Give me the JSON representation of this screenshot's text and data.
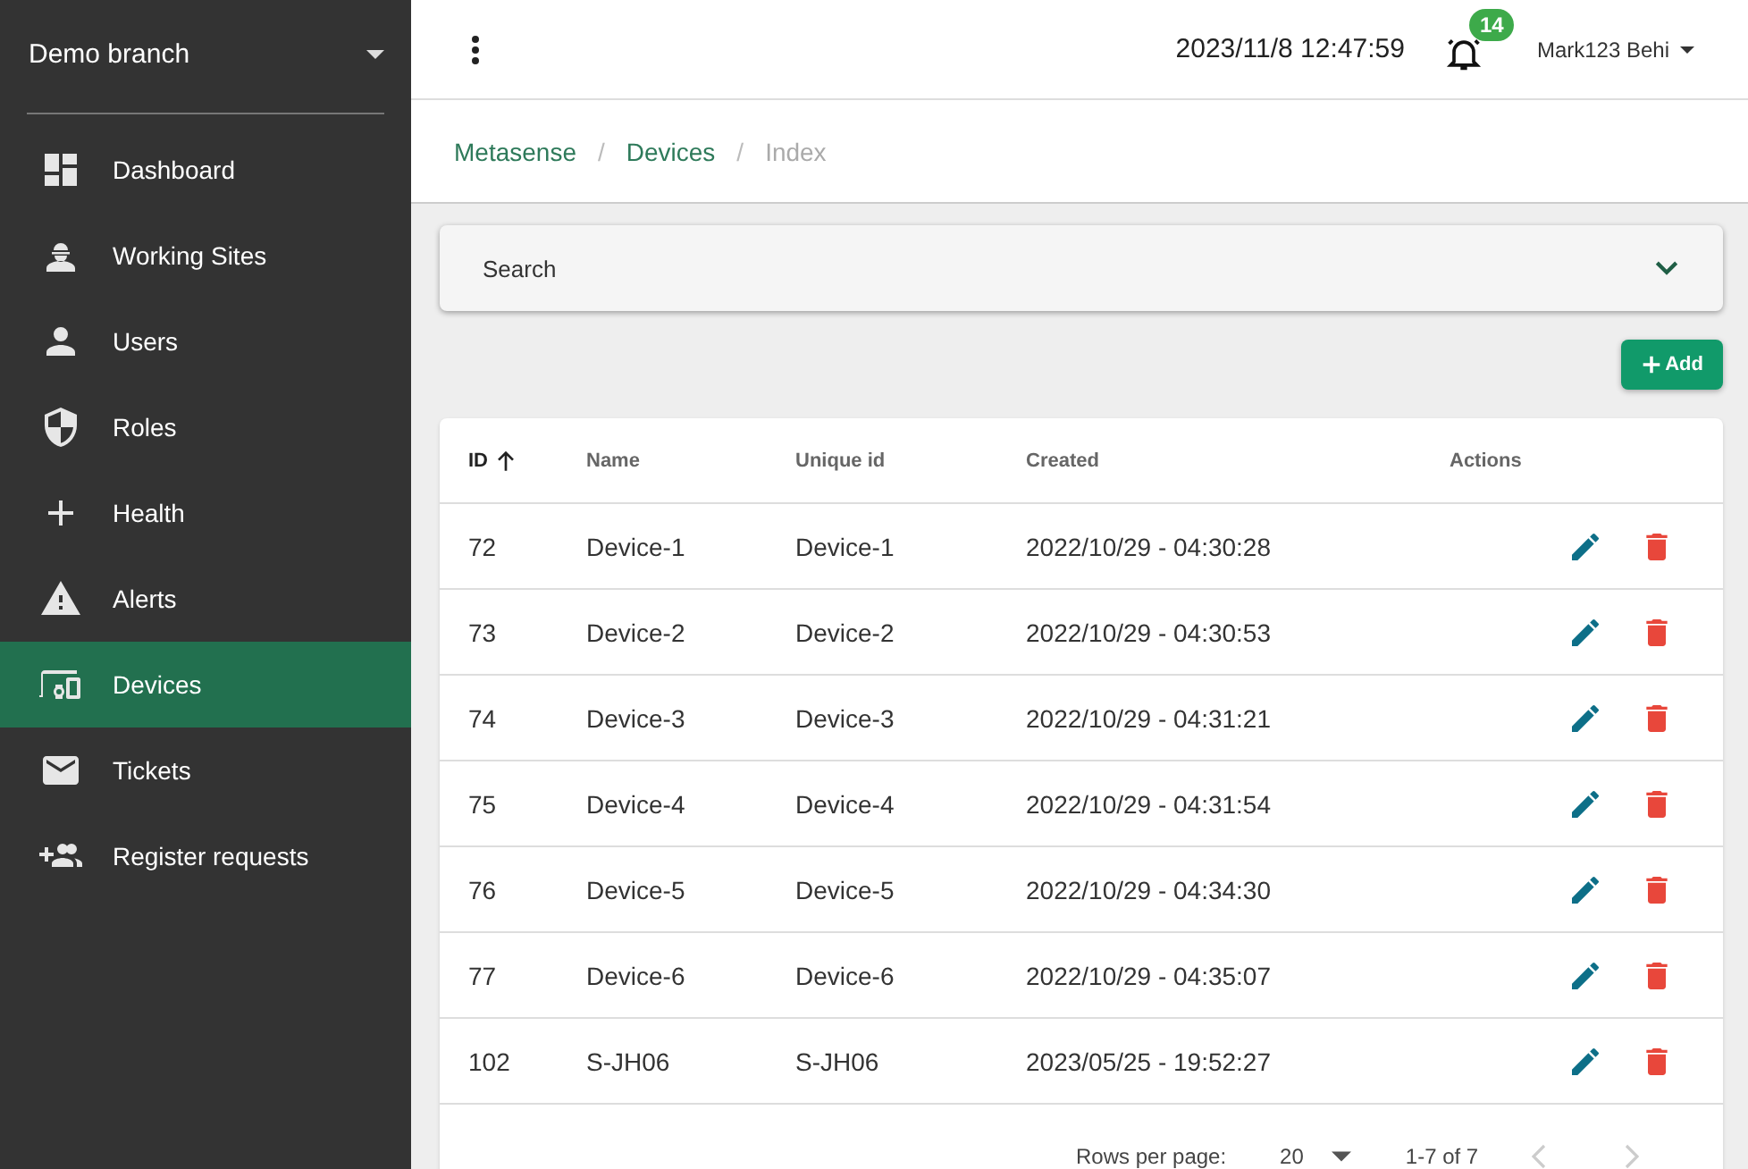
{
  "sidebar": {
    "branch": "Demo branch",
    "items": [
      {
        "label": "Dashboard",
        "selected": false
      },
      {
        "label": "Working Sites",
        "selected": false
      },
      {
        "label": "Users",
        "selected": false
      },
      {
        "label": "Roles",
        "selected": false
      },
      {
        "label": "Health",
        "selected": false
      },
      {
        "label": "Alerts",
        "selected": false
      },
      {
        "label": "Devices",
        "selected": true
      },
      {
        "label": "Tickets",
        "selected": false
      },
      {
        "label": "Register requests",
        "selected": false
      }
    ]
  },
  "header": {
    "datetime": "2023/11/8 12:47:59",
    "notifications": "14",
    "user": "Mark123 Behi"
  },
  "breadcrumb": [
    {
      "kind": "link",
      "label": "Metasense",
      "current": false
    },
    {
      "kind": "separator",
      "label": "/"
    },
    {
      "kind": "link",
      "label": "Devices",
      "current": false
    },
    {
      "kind": "separator",
      "label": "/"
    },
    {
      "kind": "link",
      "label": "Index",
      "current": true
    }
  ],
  "search": {
    "label": "Search",
    "expanded": false
  },
  "add_button": "Add",
  "table": {
    "columns": [
      {
        "label": "ID",
        "sorted": true
      },
      {
        "label": "Name",
        "sorted": false
      },
      {
        "label": "Unique id",
        "sorted": false
      },
      {
        "label": "Created",
        "sorted": false
      },
      {
        "label": "Actions",
        "sorted": false
      }
    ],
    "rows": [
      [
        "72",
        "Device-1",
        "Device-1",
        "2022/10/29 - 04:30:28"
      ],
      [
        "73",
        "Device-2",
        "Device-2",
        "2022/10/29 - 04:30:53"
      ],
      [
        "74",
        "Device-3",
        "Device-3",
        "2022/10/29 - 04:31:21"
      ],
      [
        "75",
        "Device-4",
        "Device-4",
        "2022/10/29 - 04:31:54"
      ],
      [
        "76",
        "Device-5",
        "Device-5",
        "2022/10/29 - 04:34:30"
      ],
      [
        "77",
        "Device-6",
        "Device-6",
        "2022/10/29 - 04:35:07"
      ],
      [
        "102",
        "S-JH06",
        "S-JH06",
        "2023/05/25 - 19:52:27"
      ]
    ]
  },
  "pagination": {
    "rows_per_page_label": "Rows per page:",
    "rows_per_page": "20",
    "range": "1-7 of 7",
    "previous_disabled": true,
    "next_disabled": true
  }
}
